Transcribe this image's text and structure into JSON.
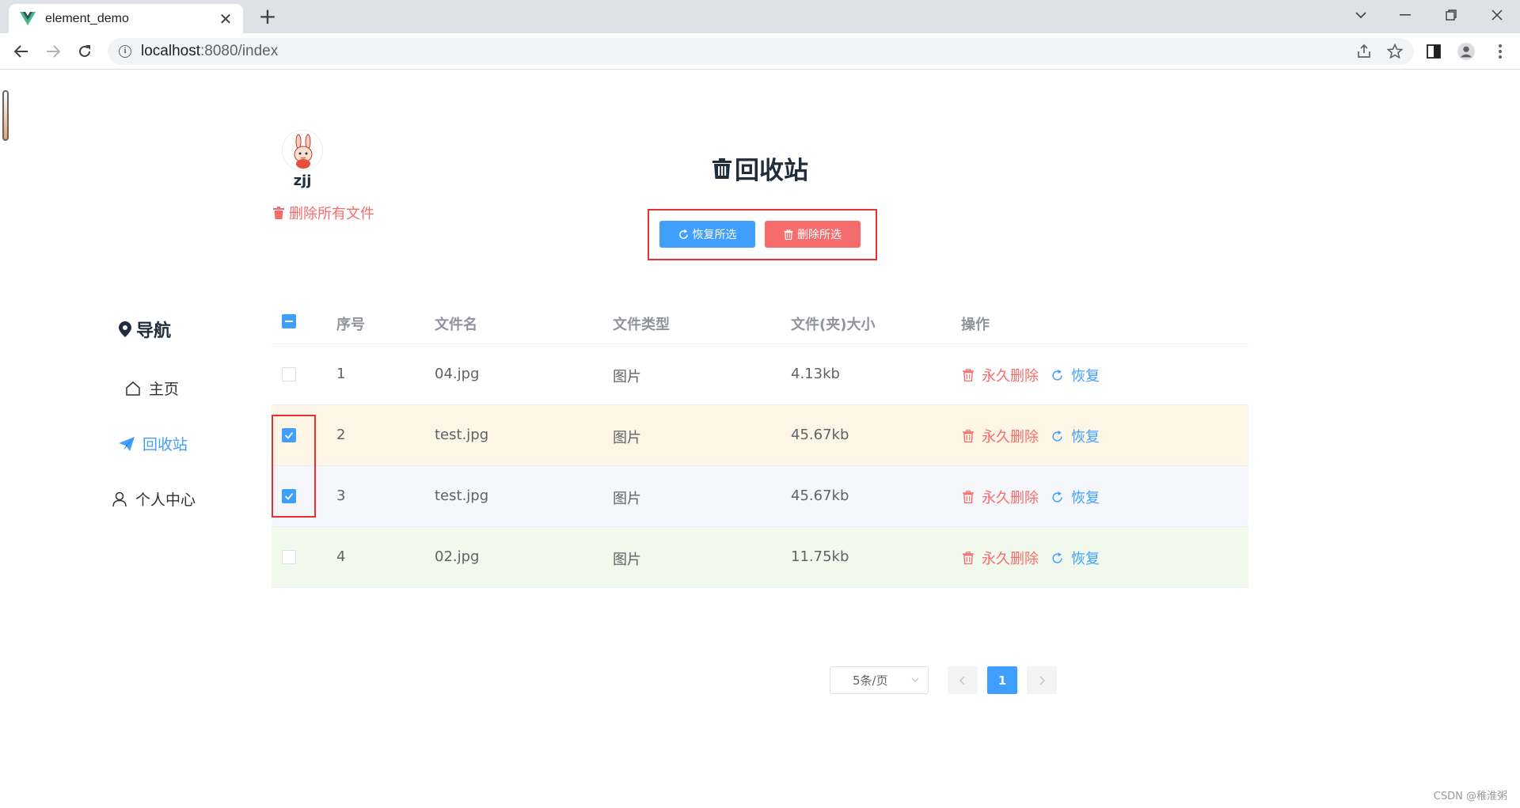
{
  "browser": {
    "tab_title": "element_demo",
    "url_host": "localhost",
    "url_path": ":8080/index"
  },
  "sidebar": {
    "username": "zjj",
    "delete_all": "删除所有文件",
    "nav_title": "导航",
    "items": [
      {
        "label": "主页",
        "icon": "home-icon",
        "active": false
      },
      {
        "label": "回收站",
        "icon": "paper-plane-icon",
        "active": true
      },
      {
        "label": "个人中心",
        "icon": "user-icon",
        "active": false
      }
    ]
  },
  "main": {
    "title": "回收站",
    "restore_selected": "恢复所选",
    "delete_selected": "删除所选"
  },
  "table": {
    "columns": [
      "序号",
      "文件名",
      "文件类型",
      "文件(夹)大小",
      "操作"
    ],
    "header_checkbox": "indeterminate",
    "rows": [
      {
        "index": "1",
        "name": "04.jpg",
        "type": "图片",
        "size": "4.13kb",
        "checked": false,
        "bg": "#ffffff"
      },
      {
        "index": "2",
        "name": "test.jpg",
        "type": "图片",
        "size": "45.67kb",
        "checked": true,
        "bg": "#fdf5e6"
      },
      {
        "index": "3",
        "name": "test.jpg",
        "type": "图片",
        "size": "45.67kb",
        "checked": true,
        "bg": "#f5f7fa"
      },
      {
        "index": "4",
        "name": "02.jpg",
        "type": "图片",
        "size": "11.75kb",
        "checked": false,
        "bg": "#f0f9eb"
      }
    ],
    "action_delete": "永久删除",
    "action_restore": "恢复"
  },
  "pagination": {
    "page_size": "5条/页",
    "current_page": "1"
  },
  "watermark": "CSDN @稚淮粥",
  "colors": {
    "primary": "#409eff",
    "danger": "#f56c6c",
    "highlight_border": "#e8312f"
  }
}
